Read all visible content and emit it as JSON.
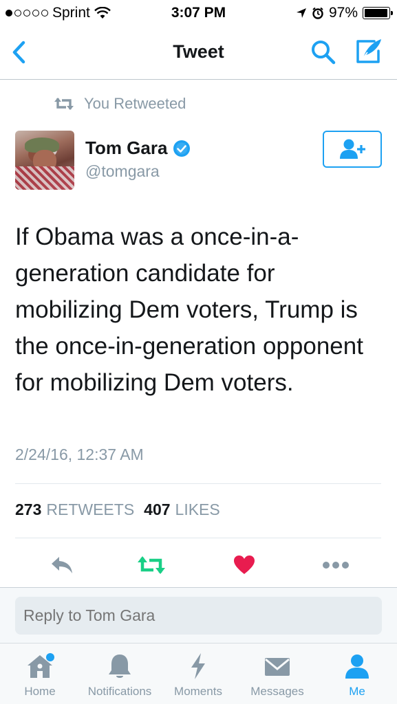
{
  "status_bar": {
    "carrier": "Sprint",
    "time": "3:07 PM",
    "battery": "97%",
    "battery_level": 0.97,
    "signal_bars_filled": 1,
    "signal_bars_total": 5
  },
  "nav": {
    "title": "Tweet",
    "icons": [
      "back-chevron-icon",
      "search-icon",
      "compose-icon"
    ]
  },
  "context": {
    "retweeted_label": "You Retweeted"
  },
  "tweet": {
    "author_name": "Tom Gara",
    "author_handle": "@tomgara",
    "verified": true,
    "text": "If Obama was a once-in-a-generation candidate for mobilizing Dem voters, Trump is the once-in-generation opponent for mobilizing Dem voters.",
    "timestamp": "2/24/16, 12:37 AM",
    "retweet_count": "273",
    "retweet_label": "RETWEETS",
    "like_count": "407",
    "like_label": "LIKES"
  },
  "reply": {
    "placeholder": "Reply to Tom Gara"
  },
  "tabs": [
    {
      "label": "Home",
      "icon": "home-icon",
      "active": false,
      "badge_dot": true
    },
    {
      "label": "Notifications",
      "icon": "bell-icon",
      "active": false
    },
    {
      "label": "Moments",
      "icon": "lightning-icon",
      "active": false
    },
    {
      "label": "Messages",
      "icon": "envelope-icon",
      "active": false
    },
    {
      "label": "Me",
      "icon": "person-icon",
      "active": true
    }
  ],
  "colors": {
    "accent": "#1da1f2",
    "retweet_active": "#19cf86",
    "like_active": "#e81c4f",
    "muted": "#8899a6"
  }
}
